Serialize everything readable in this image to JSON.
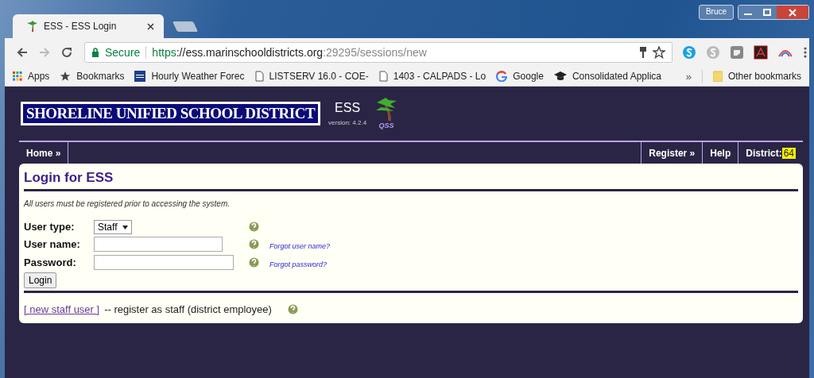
{
  "window": {
    "user": "Bruce"
  },
  "tabs": [
    {
      "title": "ESS - ESS Login",
      "selected": true
    }
  ],
  "address_bar": {
    "secure_label": "Secure",
    "scheme": "https",
    "host": "://ess.marinschooldistricts.org",
    "path": ":29295/sessions/new"
  },
  "bookmarks": [
    {
      "label": "Apps",
      "kind": "apps"
    },
    {
      "label": "Bookmarks",
      "kind": "star"
    },
    {
      "label": "Hourly Weather Forec",
      "kind": "weather"
    },
    {
      "label": "LISTSERV 16.0 - COE-",
      "kind": "page"
    },
    {
      "label": "1403 - CALPADS - Lo",
      "kind": "page"
    },
    {
      "label": "Google",
      "kind": "google"
    },
    {
      "label": "Consolidated Applica",
      "kind": "cap"
    }
  ],
  "bookmarks_overflow": "»",
  "other_bookmarks": "Other bookmarks",
  "header": {
    "banner": "SHORELINE UNIFIED SCHOOL DISTRICT",
    "app_name": "ESS",
    "version": "version: 4.2.4",
    "brand": "QSS"
  },
  "nav": {
    "left": [
      {
        "label": "Home »"
      }
    ],
    "right": [
      {
        "label": "Register »"
      },
      {
        "label": "Help"
      }
    ],
    "district_label": "District:",
    "district_number": "64"
  },
  "login": {
    "title": "Login for ESS",
    "notice": "All users must be registered prior to accessing the system.",
    "fields": [
      {
        "kind": "select",
        "label": "User type:",
        "value": "Staff"
      },
      {
        "kind": "text",
        "label": "User name:",
        "link": "Forgot user name?"
      },
      {
        "kind": "password",
        "label": "Password:",
        "link": "Forgot password?"
      }
    ],
    "submit": "Login",
    "register_link": "[ new staff user ]",
    "register_text": "-- register as staff (district employee)"
  }
}
